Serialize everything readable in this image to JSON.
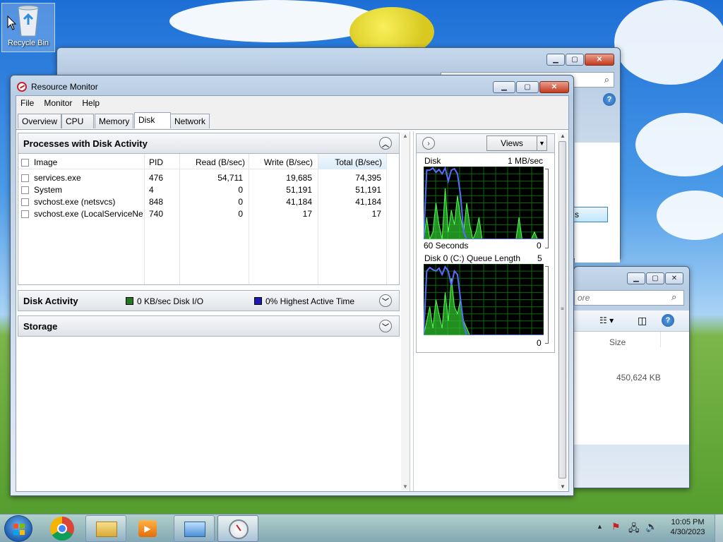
{
  "desktop": {
    "recycle_bin_label": "Recycle Bin"
  },
  "resource_monitor": {
    "title": "Resource Monitor",
    "menu": [
      "File",
      "Monitor",
      "Help"
    ],
    "tabs": [
      "Overview",
      "CPU",
      "Memory",
      "Disk",
      "Network"
    ],
    "active_tab": "Disk",
    "processes_panel": {
      "title": "Processes with Disk Activity",
      "columns": [
        "Image",
        "PID",
        "Read (B/sec)",
        "Write (B/sec)",
        "Total (B/sec)"
      ],
      "rows": [
        {
          "image": "services.exe",
          "pid": "476",
          "read": "54,711",
          "write": "19,685",
          "total": "74,395"
        },
        {
          "image": "System",
          "pid": "4",
          "read": "0",
          "write": "51,191",
          "total": "51,191"
        },
        {
          "image": "svchost.exe (netsvcs)",
          "pid": "848",
          "read": "0",
          "write": "41,184",
          "total": "41,184"
        },
        {
          "image": "svchost.exe (LocalServiceNet...",
          "pid": "740",
          "read": "0",
          "write": "17",
          "total": "17"
        }
      ]
    },
    "disk_activity_panel": {
      "title": "Disk Activity",
      "legend_io": "0 KB/sec Disk I/O",
      "legend_active": "0% Highest Active Time",
      "io_color": "#1f7a1f",
      "active_color": "#1a1ab0"
    },
    "storage_panel": {
      "title": "Storage"
    },
    "right_pane": {
      "views_label": "Views",
      "disk_graph": {
        "title": "Disk",
        "max_label": "1 MB/sec",
        "time_label": "60 Seconds",
        "min_label": "0"
      },
      "queue_graph": {
        "title": "Disk 0 (C:) Queue Length",
        "max_label": "5",
        "min_label": "0"
      }
    }
  },
  "explorer_window": {
    "search_placeholder": "ore",
    "size_column": "Size",
    "file_size": "450,624 KB"
  },
  "back_window": {
    "partial_button": "s"
  },
  "taskbar": {
    "time": "10:05 PM",
    "date": "4/30/2023"
  }
}
